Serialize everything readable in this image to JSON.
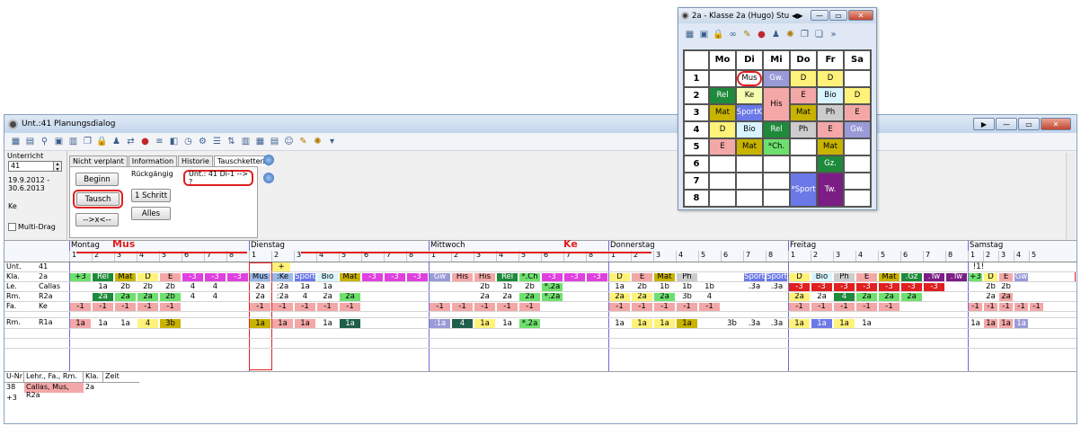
{
  "main": {
    "title": "Unt.:41 Planungsdialog",
    "win_buttons": [
      "▶",
      "—",
      "▭",
      "✕"
    ]
  },
  "dialog": {
    "field_label": "Unterricht",
    "field_value": "41",
    "dates": [
      "19.9.2012 -",
      "30.6.2013"
    ],
    "teacher_field": "Ke",
    "multidrag_label": "Multi-Drag",
    "tabs": [
      "Nicht verplant",
      "Information",
      "Historie",
      "Tauschketten"
    ],
    "beginn": "Beginn",
    "tausch": "Tausch",
    "swap": "-->x<--",
    "rueckgaengig": "Rückgängig",
    "ein_schritt": "1 Schritt",
    "alles": "Alles",
    "chain_text": "Unt.: 41  Di-1 --> ?"
  },
  "plan": {
    "days": [
      "Montag",
      "Dienstag",
      "Mittwoch",
      "Donnerstag",
      "Freitag",
      "Samstag"
    ],
    "annotation_mus": "Mus",
    "annotation_ke": "Ke",
    "row_labels": [
      [
        "Unt.",
        "41"
      ],
      [
        "Kla.",
        "2a"
      ],
      [
        "Le.",
        "Callas"
      ],
      [
        "Rm.",
        "R2a"
      ],
      [
        "Fa.",
        "Ke"
      ],
      [
        "Rm.",
        "R1a"
      ]
    ],
    "marker_plus": "+",
    "marker_exc": "!1!"
  },
  "bottom": {
    "headers": [
      "U-Nr",
      "Lehr., Fa., Rm.",
      "Kla.",
      "Zeit"
    ],
    "row": [
      "38",
      "Callas, Mus, R2a",
      "2a",
      ""
    ],
    "row2": [
      "+3"
    ]
  },
  "popup": {
    "title": "2a - Klasse 2a (Hugo)  Stu",
    "headers": [
      "Mo",
      "Di",
      "Mi",
      "Do",
      "Fr",
      "Sa"
    ],
    "periods": [
      "1",
      "2",
      "3",
      "4",
      "5",
      "6",
      "7",
      "8"
    ],
    "cells": {
      "r1": [
        "",
        "Mus",
        "Gw.",
        "D",
        "D",
        ""
      ],
      "r2": [
        "Rel",
        "Ke",
        "His",
        "E",
        "Bio",
        "D"
      ],
      "r3": [
        "Mat",
        "SportK",
        "",
        "Mat",
        "Ph",
        "E"
      ],
      "r4": [
        "D",
        "Bio",
        "Rel",
        "Ph",
        "E",
        "Gw."
      ],
      "r5": [
        "E",
        "Mat",
        "*Ch.",
        "",
        "Mat",
        ""
      ],
      "r6": [
        "",
        "",
        "",
        "",
        "Gz.",
        ""
      ],
      "r7": [
        "",
        "",
        "",
        "*Sport",
        "Tw.",
        ""
      ]
    }
  },
  "colors": {
    "accent_red": "#e02020",
    "green": "#1e8a3b",
    "pink": "#f4a7a7",
    "yellow": "#fff27a",
    "olive": "#c7b300",
    "purple": "#7a1d84",
    "blue": "#6a78e8"
  }
}
